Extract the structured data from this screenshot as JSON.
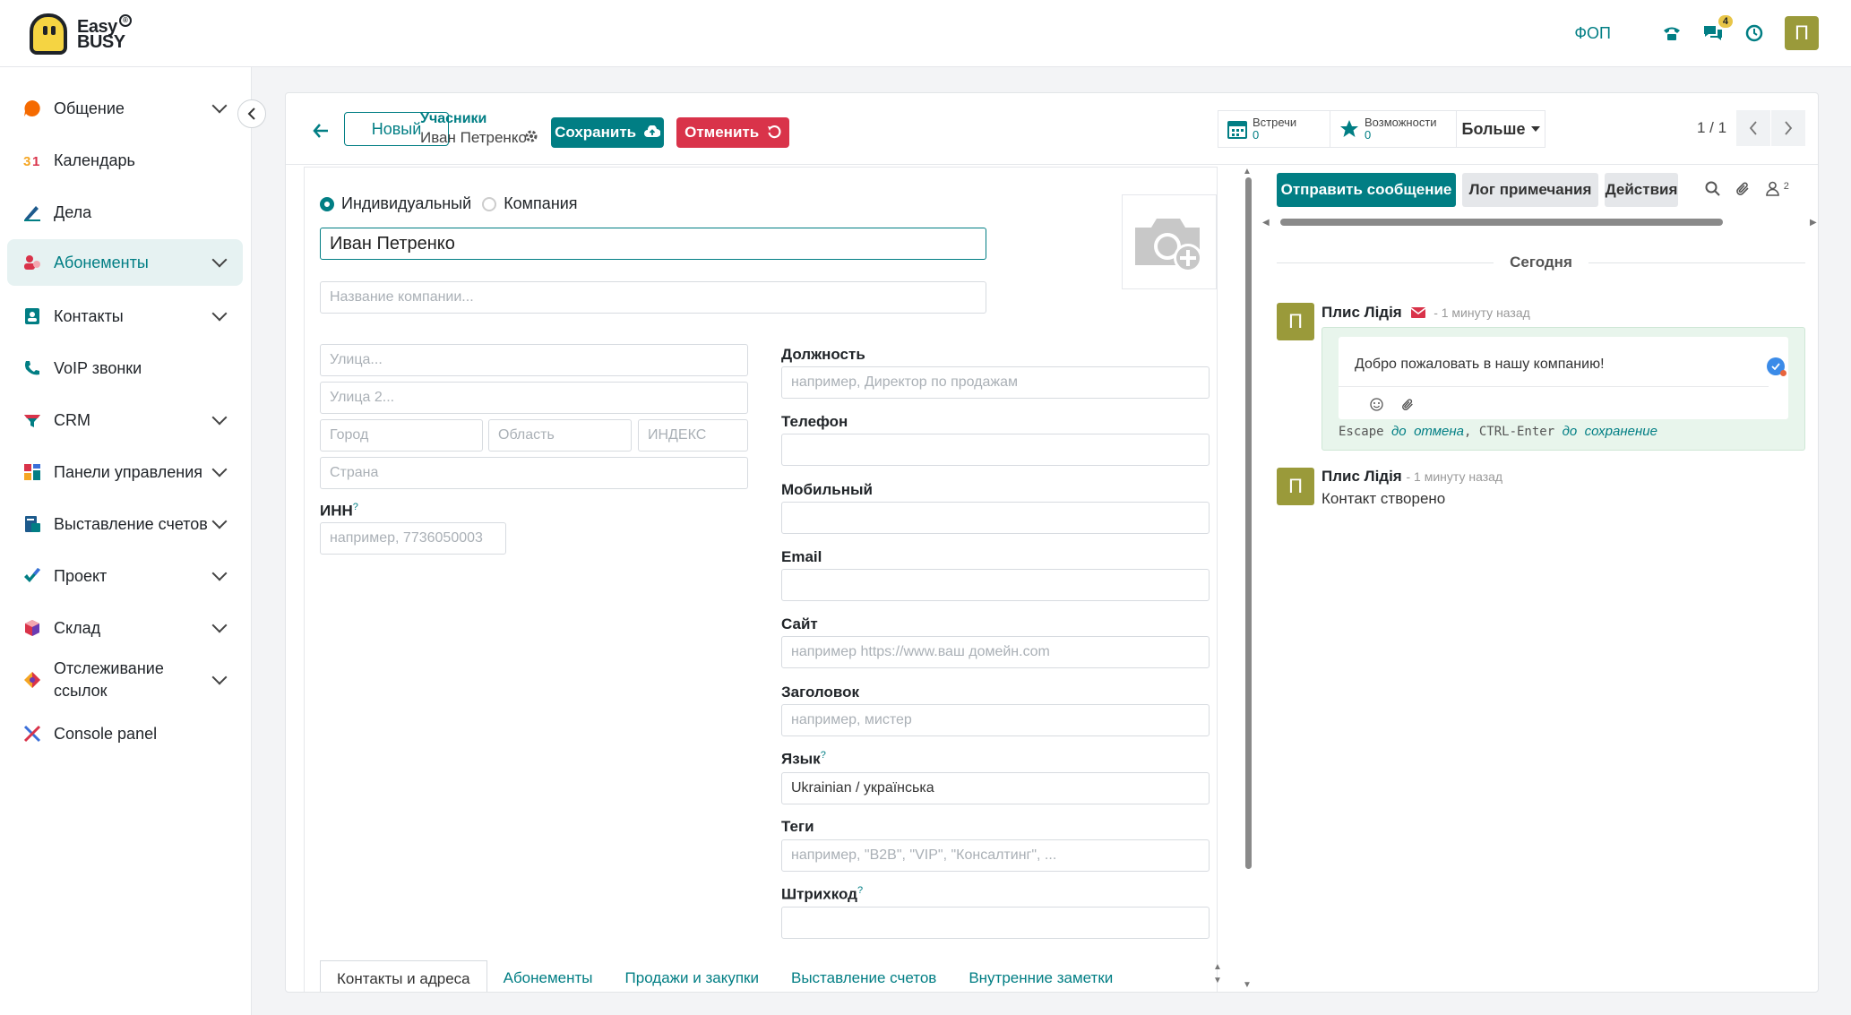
{
  "brand": {
    "line1": "Easy",
    "line2": "BUSY",
    "reg": "®"
  },
  "topbar": {
    "company": "ФОП",
    "chat_count": "4",
    "avatar_letter": "П"
  },
  "sidebar": {
    "items": [
      {
        "label": "Общение",
        "icon": "chat-bubble-icon",
        "color": "#f56a00"
      },
      {
        "label": "Календарь",
        "icon": "calendar-31-icon",
        "color": "#d9334a"
      },
      {
        "label": "Дела",
        "icon": "pen-icon",
        "color": "#017e84"
      },
      {
        "label": "Абонементы",
        "icon": "subscriptions-icon",
        "color": "#d9334a"
      },
      {
        "label": "Контакты",
        "icon": "address-book-icon",
        "color": "#017e84"
      },
      {
        "label": "VoIP звонки",
        "icon": "phone-icon",
        "color": "#017e84"
      },
      {
        "label": "CRM",
        "icon": "crm-funnel-icon",
        "color": "#017e84"
      },
      {
        "label": "Панели управления",
        "icon": "dashboard-icon",
        "color": "#d9334a"
      },
      {
        "label": "Выставление счетов",
        "icon": "invoice-icon",
        "color": "#017e84"
      },
      {
        "label": "Проект",
        "icon": "checkmark-icon",
        "color": "#017e84"
      },
      {
        "label": "Склад",
        "icon": "box-icon",
        "color": "#d9334a"
      },
      {
        "label": "Отслеживание ссылок",
        "icon": "link-tracker-icon",
        "color": "#f5a623"
      },
      {
        "label": "Console panel",
        "icon": "tools-icon",
        "color": "#3b6fd9"
      }
    ]
  },
  "control_panel": {
    "new_label": "Новый",
    "breadcrumb_parent": "Учасники",
    "breadcrumb_current": "Иван Петренко",
    "save_label": "Сохранить",
    "cancel_label": "Отменить",
    "meetings_label": "Встречи",
    "meetings_count": "0",
    "opportunities_label": "Возможности",
    "opportunities_count": "0",
    "more_label": "Больше",
    "pager": "1 / 1"
  },
  "form": {
    "type_individual": "Индивидуальный",
    "type_company": "Компания",
    "name": "Иван Петренко",
    "company_placeholder": "Название компании...",
    "street_placeholder": "Улица...",
    "street2_placeholder": "Улица 2...",
    "city_placeholder": "Город",
    "state_placeholder": "Область",
    "zip_placeholder": "ИНДЕКС",
    "country_placeholder": "Страна",
    "inn_label": "ИНН",
    "inn_placeholder": "например, 7736050003",
    "job_label": "Должность",
    "job_placeholder": "например, Директор по продажам",
    "phone_label": "Телефон",
    "mobile_label": "Мобильный",
    "email_label": "Email",
    "site_label": "Сайт",
    "site_placeholder": "например https://www.ваш домейн.com",
    "title_label": "Заголовок",
    "title_placeholder": "например, мистер",
    "lang_label": "Язык",
    "lang_value": "Ukrainian / українська",
    "tags_label": "Теги",
    "tags_placeholder": "например, \"B2B\", \"VIP\", \"Консалтинг\", ...",
    "barcode_label": "Штрихкод",
    "help_mark": "?",
    "tabs": [
      "Контакты и адреса",
      "Абонементы",
      "Продажи и закупки",
      "Выставление счетов",
      "Внутренние заметки"
    ]
  },
  "chatter": {
    "send_label": "Отправить сообщение",
    "log_label": "Лог примечания",
    "actions_label": "Действия",
    "followers_count": "2",
    "today_label": "Сегодня",
    "messages": [
      {
        "avatar": "П",
        "author": "Плис Лідія",
        "time": "- 1 минуту назад",
        "body": "Добро пожаловать в нашу компанию!"
      },
      {
        "avatar": "П",
        "author": "Плис Лідія",
        "time": "- 1 минуту назад",
        "body": "Контакт створено"
      }
    ],
    "hint_escape": "Escape",
    "hint_do1": "до",
    "hint_cancel": "отмена",
    "hint_ctrl": ", CTRL-Enter",
    "hint_do2": "до",
    "hint_save": "сохранение"
  }
}
